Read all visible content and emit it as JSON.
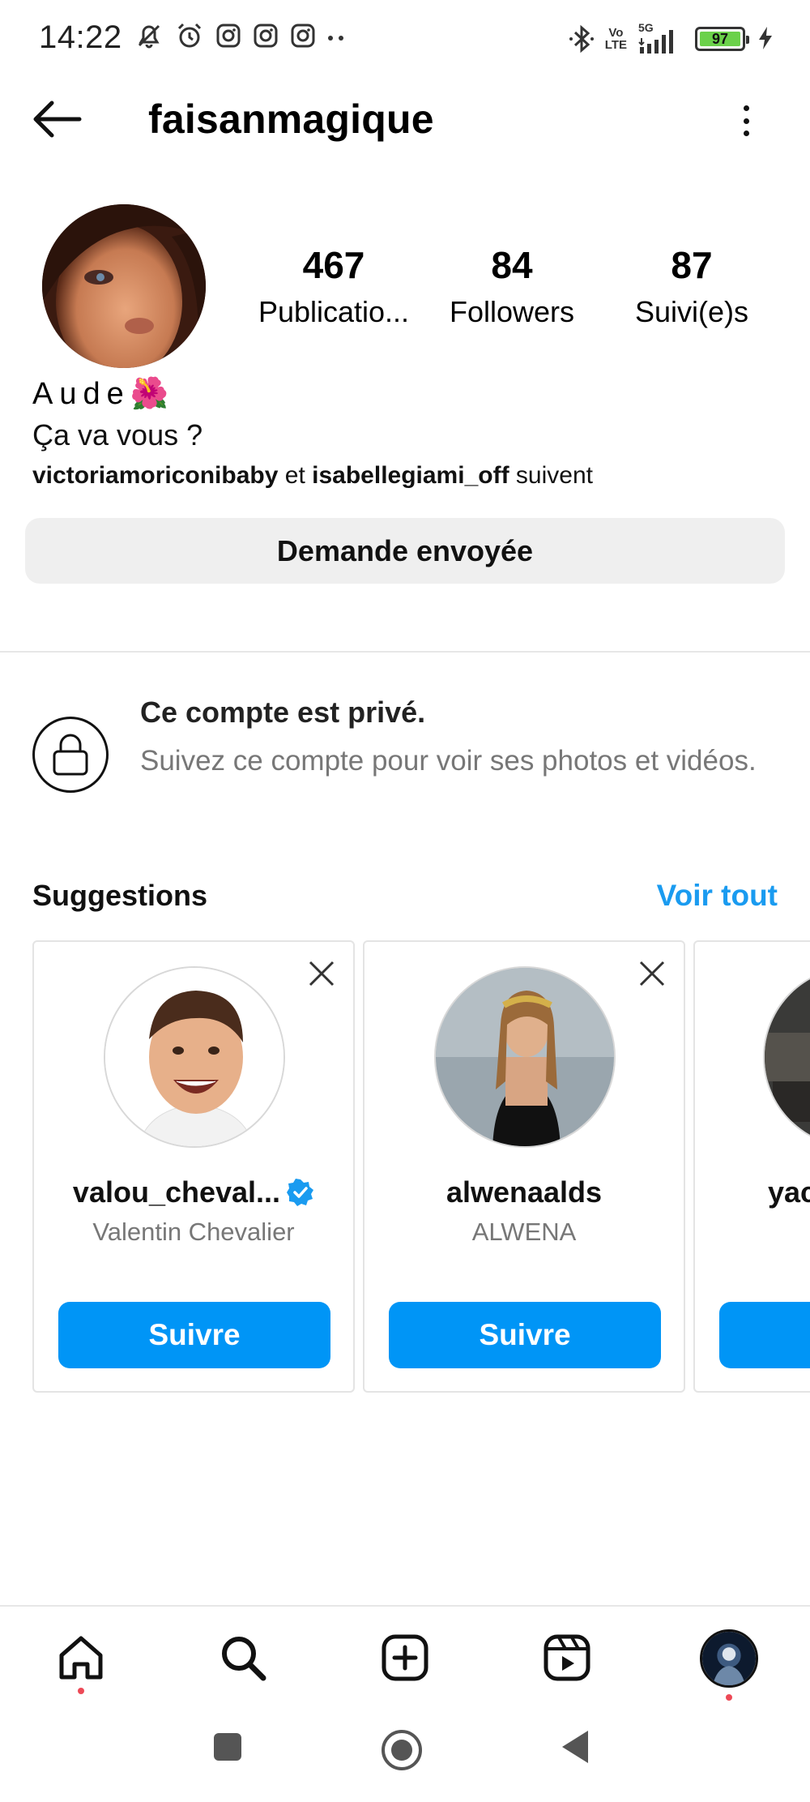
{
  "status_bar": {
    "time": "14:22",
    "network_top": "Vo",
    "network_bottom": "LTE",
    "network_gen": "5G",
    "battery": "97"
  },
  "header": {
    "username": "faisanmagique"
  },
  "profile": {
    "stats": [
      {
        "value": "467",
        "label": "Publicatio..."
      },
      {
        "value": "84",
        "label": "Followers"
      },
      {
        "value": "87",
        "label": "Suivi(e)s"
      }
    ],
    "name": "Aude",
    "emoji": "🌺",
    "bio": "Ça va vous ?",
    "followed_by_1": "victoriamoriconibaby",
    "followed_by_join": "et",
    "followed_by_2": "isabellegiami_off",
    "followed_by_suffix": "suivent",
    "request_button": "Demande envoyée"
  },
  "private": {
    "title": "Ce compte est privé.",
    "text": "Suivez ce compte pour voir ses photos et vidéos."
  },
  "suggestions": {
    "heading": "Suggestions",
    "see_all": "Voir tout",
    "cards": [
      {
        "username": "valou_cheval...",
        "verified": true,
        "name": "Valentin Chevalier",
        "button": "Suivre"
      },
      {
        "username": "alwenaalds",
        "verified": false,
        "name": "ALWENA",
        "button": "Suivre"
      },
      {
        "username": "yac",
        "verified": false,
        "name": "",
        "button": ""
      }
    ]
  },
  "colors": {
    "accent": "#0095f6",
    "link": "#1a9bf0",
    "notification_dot": "#ed4956",
    "battery": "#6bd14a"
  },
  "icons": {
    "bottom_nav": [
      "home-icon",
      "search-icon",
      "create-icon",
      "reels-icon",
      "profile-avatar"
    ],
    "android_nav": [
      "recents-icon",
      "home-circle-icon",
      "back-triangle-icon"
    ]
  }
}
